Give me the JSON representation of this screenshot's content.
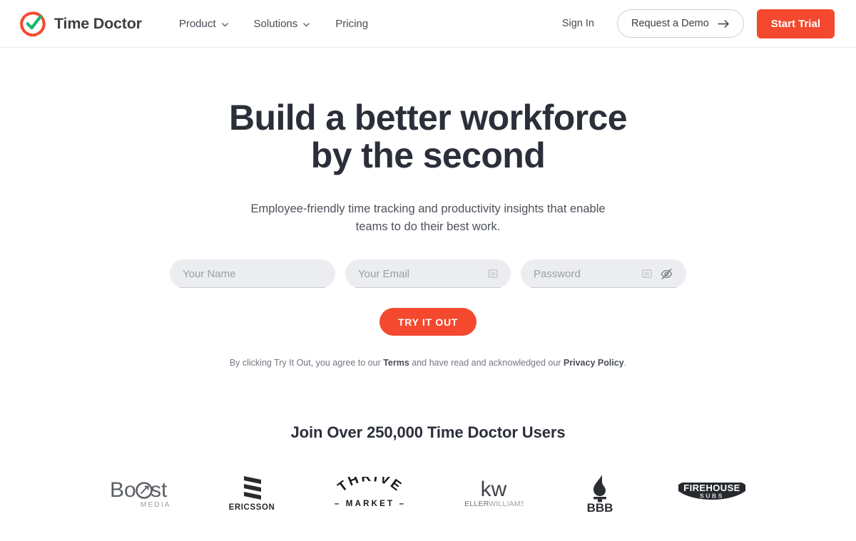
{
  "brand": {
    "name": "Time Doctor",
    "logo_icon": "timedoctor-check-circle-logo",
    "ring_color": "#f4492e",
    "check_color": "#1bb76e"
  },
  "header": {
    "nav": [
      {
        "label": "Product",
        "has_dropdown": true,
        "icon": "chevron-down-icon"
      },
      {
        "label": "Solutions",
        "has_dropdown": true,
        "icon": "chevron-down-icon"
      },
      {
        "label": "Pricing",
        "has_dropdown": false,
        "icon": ""
      }
    ],
    "sign_in": "Sign In",
    "demo_button": "Request a Demo",
    "demo_icon": "arrow-right-icon",
    "trial_button": "Start Trial",
    "accent_color": "#f4492e"
  },
  "hero": {
    "title_line1": "Build a better workforce",
    "title_line2": "by the second",
    "subtitle": "Employee-friendly time tracking and productivity insights that enable teams to do their best work."
  },
  "form": {
    "name_placeholder": "Your Name",
    "name_value": "",
    "email_placeholder": "Your Email",
    "email_value": "",
    "email_icon": "broken-image-icon",
    "password_placeholder": "Password",
    "password_value": "",
    "password_icon": "broken-image-icon",
    "password_toggle_icon": "eye-off-icon",
    "submit_label": "TRY IT OUT"
  },
  "legal": {
    "prefix": "By clicking Try It Out, you agree to our ",
    "terms": "Terms",
    "middle": " and have read and acknowledged our ",
    "privacy": "Privacy Policy",
    "suffix": "."
  },
  "proof": {
    "heading": "Join Over 250,000 Time Doctor Users",
    "logos": [
      {
        "name": "Boost Media",
        "icon": "boost-media-logo",
        "text": "Boost",
        "subtext": "MEDIA"
      },
      {
        "name": "Ericsson",
        "icon": "ericsson-logo",
        "text": "ERICSSON",
        "subtext": ""
      },
      {
        "name": "Thrive Market",
        "icon": "thrive-market-logo",
        "text": "THRIVE",
        "subtext": "- MARKET -"
      },
      {
        "name": "Keller Williams",
        "icon": "keller-williams-logo",
        "text": "kw",
        "subtext": "KELLERWILLIAMS."
      },
      {
        "name": "BBB",
        "icon": "bbb-logo",
        "text": "BBB",
        "subtext": ""
      },
      {
        "name": "Firehouse Subs",
        "icon": "firehouse-subs-logo",
        "text": "FIREHOUSE",
        "subtext": "SUBS"
      }
    ]
  }
}
